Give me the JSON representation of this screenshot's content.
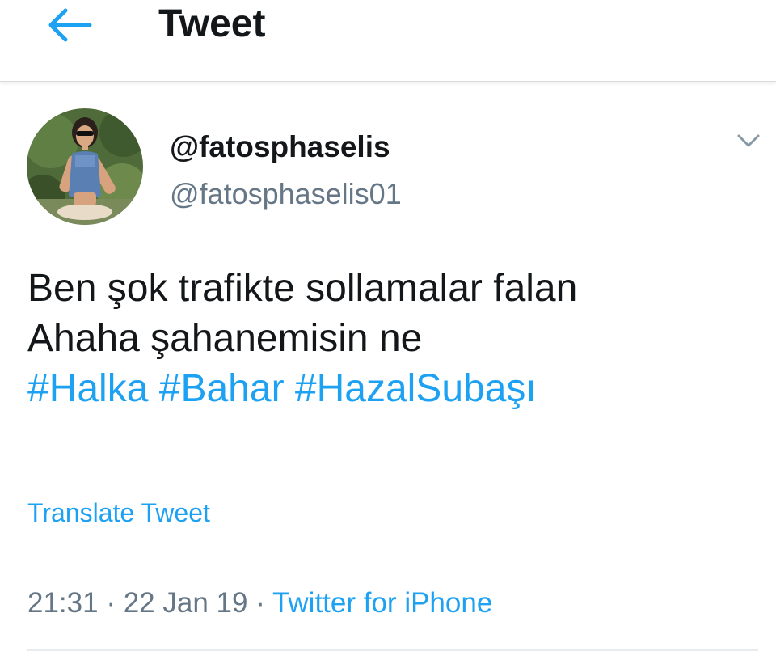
{
  "header": {
    "back_icon": "arrow-left-icon",
    "title": "Tweet"
  },
  "author": {
    "display_name": "@fatosphaselis",
    "handle": "@fatosphaselis01",
    "more_icon": "chevron-down-icon"
  },
  "tweet": {
    "lines": [
      "Ben şok trafikte sollamalar falan",
      "Ahaha şahanemisin ne"
    ],
    "hashtags": [
      "#Halka",
      "#Bahar",
      "#HazalSubaşı"
    ]
  },
  "translate_label": "Translate Tweet",
  "meta": {
    "time": "21:31",
    "separator": "·",
    "date": "22 Jan 19",
    "source": "Twitter for iPhone"
  },
  "colors": {
    "accent": "#1da1f2",
    "secondary_text": "#657786",
    "primary_text": "#14171a"
  }
}
